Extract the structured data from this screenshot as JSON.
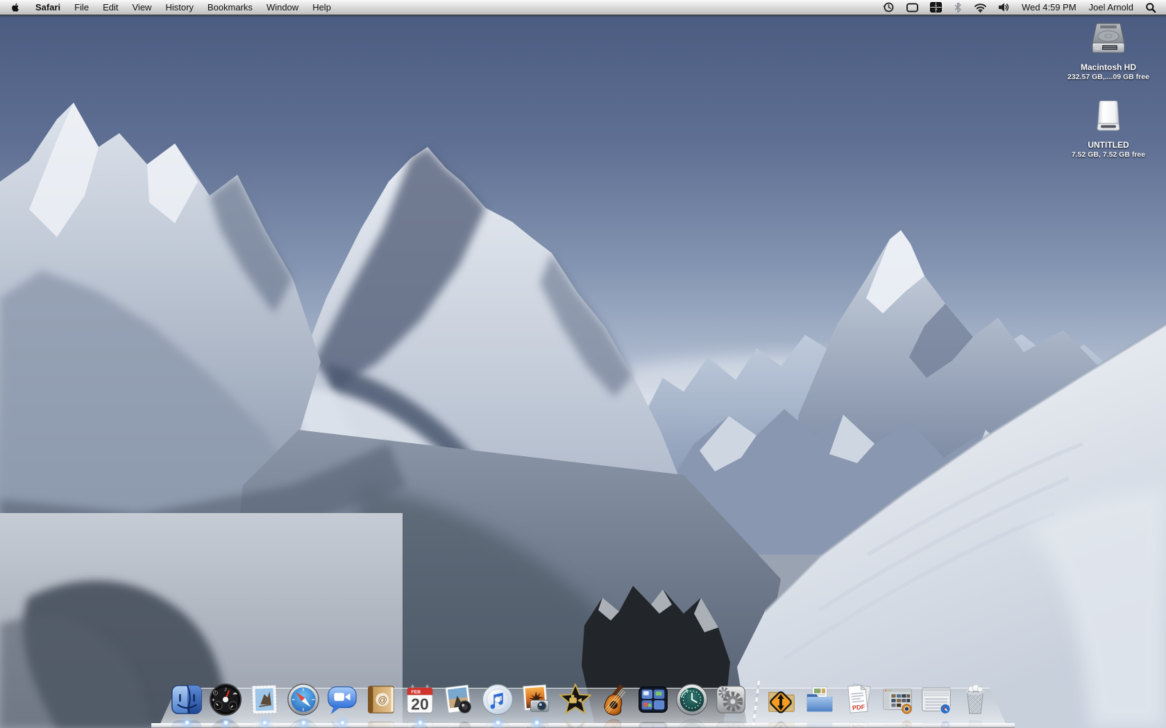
{
  "menu_bar": {
    "active_app": "Safari",
    "menus": [
      "Safari",
      "File",
      "Edit",
      "View",
      "History",
      "Bookmarks",
      "Window",
      "Help"
    ],
    "status": {
      "icons": [
        "time-machine",
        "ichat",
        "spaces",
        "bluetooth",
        "wifi",
        "volume"
      ],
      "spaces_number": "1",
      "clock": "Wed 4:59 PM",
      "user_name": "Joel Arnold"
    }
  },
  "desktop": {
    "wallpaper": "snowy-alpine-mountains",
    "volumes": [
      {
        "label": "Macintosh HD",
        "detail": "232.57 GB,....09 GB free",
        "kind": "internal-hard-drive"
      },
      {
        "label": "UNTITLED",
        "detail": "7.52 GB, 7.52 GB free",
        "kind": "removable-drive"
      }
    ]
  },
  "dock": {
    "apps": [
      "finder",
      "dashboard",
      "mail",
      "safari",
      "ichat",
      "address-book",
      "ical",
      "photo-booth",
      "itunes",
      "iphoto",
      "imovie",
      "garageband",
      "spaces",
      "time-machine",
      "system-preferences"
    ],
    "right_side": [
      "downloads-stack",
      "documents-stack",
      "pdf-stack",
      "iphoto-minimized-window",
      "safari-minimized-window",
      "trash"
    ],
    "running_apps": [
      "finder",
      "dashboard",
      "mail",
      "safari",
      "ichat",
      "ical",
      "itunes",
      "iphoto"
    ],
    "ical": {
      "month": "FEB",
      "day": "20"
    },
    "pdf_label": "PDF",
    "trash_state": "full"
  },
  "colors": {
    "menu_bar_text": "#111111",
    "sky_top": "#49597f",
    "sky_horizon": "#dce2ea",
    "snow_bright": "#f2f4f8",
    "snow_shadow": "#4c5870",
    "dock_shelf": "rgba(210,215,221,0.6)",
    "running_indicator": "#aad4ff",
    "label_text": "#ffffff"
  }
}
